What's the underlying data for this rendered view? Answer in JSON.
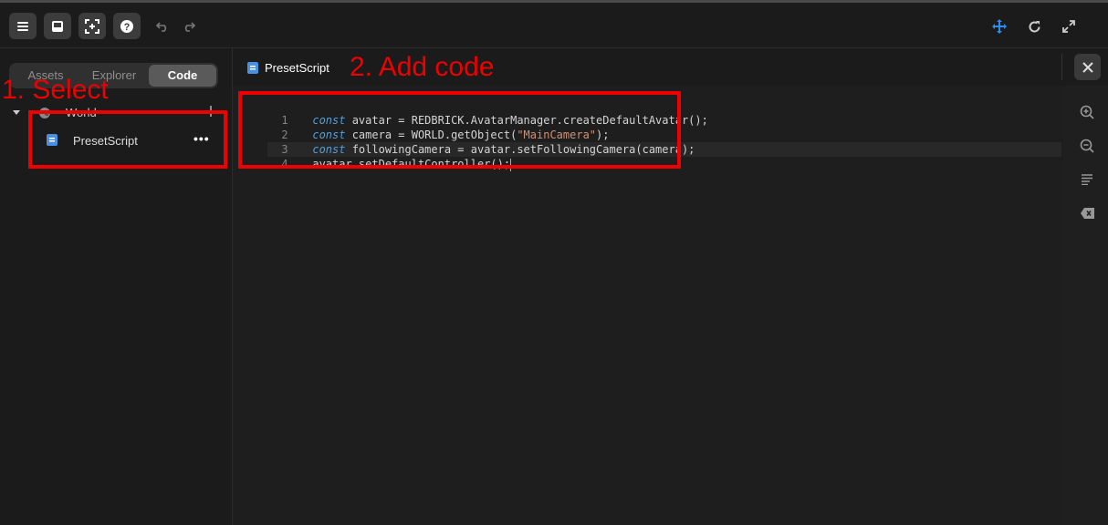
{
  "toolbar": {
    "buttons": [
      {
        "icon": "menu-icon"
      },
      {
        "icon": "inbox-icon"
      },
      {
        "icon": "add-frame-icon"
      },
      {
        "icon": "help-icon"
      }
    ],
    "undo_icon": "undo-icon",
    "redo_icon": "redo-icon",
    "right_icons": [
      "move-icon",
      "refresh-icon",
      "expand-icon"
    ],
    "accent": "#2d8cf0"
  },
  "sidebar": {
    "tabs": [
      {
        "label": "Assets",
        "active": false
      },
      {
        "label": "Explorer",
        "active": false
      },
      {
        "label": "Code",
        "active": true
      }
    ],
    "tree": {
      "root_label": "World",
      "add_icon": "plus-icon",
      "children": [
        {
          "label": "PresetScript",
          "more": "•••"
        }
      ]
    }
  },
  "editor": {
    "file_tab": "PresetScript",
    "lines": [
      {
        "num": "1",
        "kw": "const",
        "rest": " avatar = REDBRICK.AvatarManager.createDefaultAvatar();"
      },
      {
        "num": "2",
        "kw": "const",
        "pre": " camera = WORLD.getObject(",
        "str": "\"MainCamera\"",
        "post": ");"
      },
      {
        "num": "3",
        "kw": "const",
        "rest": " followingCamera = avatar.setFollowingCamera(camera);"
      },
      {
        "num": "4",
        "kw": "",
        "rest": "avatar.setDefaultController();"
      }
    ],
    "side_tools": [
      "zoom-in-icon",
      "zoom-out-icon",
      "format-icon",
      "clear-icon"
    ]
  },
  "annotations": {
    "step1": "1. Select",
    "step2": "2. Add code",
    "color": "#e00000"
  }
}
